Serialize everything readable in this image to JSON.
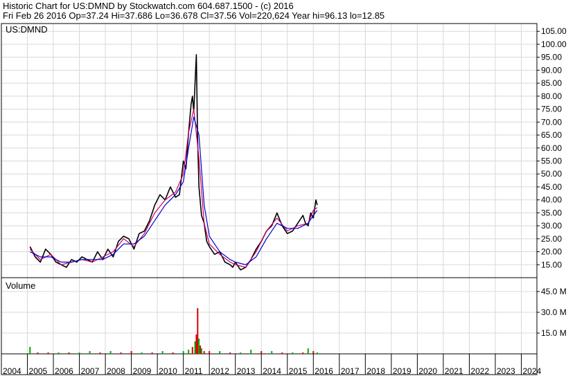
{
  "header": {
    "line1": "Historic Chart for US:DMND by Stockwatch.com 604.687.1500 - (c) 2016",
    "line2": "Fri Feb 26 2016   Op=37.24  Hi=37.686  Lo=36.678  Cl=37.56  Vol=220,624   Year hi=96.13   lo=12.85"
  },
  "chart_data": {
    "type": "line",
    "symbol_label": "US:DMND",
    "volume_label": "Volume",
    "price_axis": {
      "ylim": [
        10,
        108
      ],
      "ticks": [
        15,
        20,
        25,
        30,
        35,
        40,
        45,
        50,
        55,
        60,
        65,
        70,
        75,
        80,
        85,
        90,
        95,
        100,
        105
      ],
      "tick_labels": [
        "15.00",
        "20.00",
        "25.00",
        "30.00",
        "35.00",
        "40.00",
        "45.00",
        "50.00",
        "55.00",
        "60.00",
        "65.00",
        "70.00",
        "75.00",
        "80.00",
        "85.00",
        "90.00",
        "95.00",
        "100.00",
        "105.00"
      ]
    },
    "volume_axis": {
      "ylim": [
        0,
        55
      ],
      "ticks": [
        15,
        30,
        45
      ],
      "tick_labels": [
        "15.0 M",
        "30.0 M",
        "45.0 M"
      ]
    },
    "x_axis": {
      "range": [
        2004,
        2024.6
      ],
      "tick_labels": [
        "2004",
        "2005",
        "2006",
        "2007",
        "2008",
        "2009",
        "2010",
        "2011",
        "2012",
        "2013",
        "2014",
        "2015",
        "2016",
        "2017",
        "2018",
        "2019",
        "2020",
        "2021",
        "2022",
        "2023",
        "2024"
      ]
    },
    "grid": true,
    "colors": {
      "price": "#000000",
      "ma_short": "#cc0066",
      "ma_long": "#0000cc",
      "volume_up": "#00aa00",
      "volume_down": "#dd0000",
      "grid": "#d8d8d8"
    },
    "series": [
      {
        "key": "price",
        "x": [
          2005.1,
          2005.3,
          2005.5,
          2005.7,
          2005.9,
          2006.1,
          2006.3,
          2006.5,
          2006.7,
          2006.9,
          2007.1,
          2007.3,
          2007.5,
          2007.7,
          2007.9,
          2008.1,
          2008.3,
          2008.5,
          2008.7,
          2008.9,
          2009.1,
          2009.3,
          2009.5,
          2009.7,
          2009.9,
          2010.1,
          2010.3,
          2010.5,
          2010.7,
          2010.85,
          2011.0,
          2011.1,
          2011.2,
          2011.3,
          2011.35,
          2011.4,
          2011.5,
          2011.55,
          2011.6,
          2011.7,
          2011.8,
          2011.9,
          2012.0,
          2012.2,
          2012.4,
          2012.6,
          2012.8,
          2012.9,
          2013.0,
          2013.2,
          2013.4,
          2013.6,
          2013.8,
          2014.0,
          2014.2,
          2014.4,
          2014.6,
          2014.8,
          2015.0,
          2015.2,
          2015.4,
          2015.6,
          2015.7,
          2015.8,
          2015.9,
          2016.0,
          2016.1,
          2016.15
        ],
        "y": [
          22,
          18,
          16,
          21,
          19,
          16,
          15,
          14,
          17,
          16,
          18,
          17,
          16,
          20,
          17,
          21,
          18,
          24,
          26,
          25,
          21,
          27,
          28,
          32,
          38,
          42,
          40,
          45,
          41,
          42,
          55,
          52,
          66,
          77,
          80,
          74,
          96,
          63,
          45,
          34,
          31,
          24,
          22,
          19,
          20,
          16,
          15,
          14,
          16,
          13,
          14,
          17,
          21,
          24,
          28,
          30,
          35,
          30,
          27,
          28,
          31,
          34,
          31,
          30,
          35,
          33,
          40,
          38
        ]
      },
      {
        "key": "ma_short",
        "x": [
          2005.1,
          2005.5,
          2005.9,
          2006.3,
          2006.7,
          2007.1,
          2007.5,
          2007.9,
          2008.3,
          2008.7,
          2009.1,
          2009.5,
          2009.9,
          2010.3,
          2010.7,
          2011.0,
          2011.2,
          2011.4,
          2011.6,
          2011.8,
          2012.0,
          2012.4,
          2012.8,
          2013.0,
          2013.4,
          2013.8,
          2014.2,
          2014.6,
          2015.0,
          2015.4,
          2015.8,
          2016.0,
          2016.15
        ],
        "y": [
          21,
          17,
          19,
          15,
          16,
          17,
          16,
          18,
          20,
          25,
          22,
          27,
          35,
          40,
          43,
          50,
          66,
          75,
          56,
          31,
          23,
          19,
          16,
          15,
          14,
          20,
          28,
          33,
          28,
          30,
          31,
          36,
          37
        ]
      },
      {
        "key": "ma_long",
        "x": [
          2005.1,
          2005.5,
          2005.9,
          2006.3,
          2006.7,
          2007.1,
          2007.5,
          2007.9,
          2008.3,
          2008.7,
          2009.1,
          2009.5,
          2009.9,
          2010.3,
          2010.7,
          2011.0,
          2011.2,
          2011.4,
          2011.6,
          2011.8,
          2012.0,
          2012.4,
          2012.8,
          2013.0,
          2013.4,
          2013.8,
          2014.2,
          2014.6,
          2015.0,
          2015.4,
          2015.8,
          2016.0,
          2016.15
        ],
        "y": [
          20,
          18,
          18,
          16,
          16,
          17,
          17,
          17,
          19,
          23,
          23,
          26,
          32,
          38,
          42,
          47,
          60,
          72,
          65,
          38,
          26,
          20,
          17,
          16,
          15,
          18,
          25,
          31,
          29,
          29,
          31,
          34,
          36
        ]
      }
    ],
    "volume": {
      "x": [
        2005.1,
        2005.4,
        2005.8,
        2006.2,
        2006.6,
        2007.0,
        2007.4,
        2007.8,
        2008.2,
        2008.6,
        2009.0,
        2009.4,
        2009.8,
        2010.2,
        2010.6,
        2011.0,
        2011.2,
        2011.35,
        2011.45,
        2011.5,
        2011.55,
        2011.6,
        2011.65,
        2011.7,
        2011.8,
        2012.0,
        2012.4,
        2012.8,
        2013.2,
        2013.6,
        2014.0,
        2014.4,
        2014.8,
        2015.2,
        2015.6,
        2015.8,
        2016.0,
        2016.15
      ],
      "values": [
        5,
        1,
        1,
        1,
        1,
        1,
        2,
        1,
        2,
        1,
        2,
        1,
        1,
        2,
        1,
        2,
        3,
        5,
        9,
        14,
        33,
        11,
        6,
        4,
        2,
        2,
        2,
        1,
        1,
        3,
        2,
        2,
        1,
        1,
        1,
        4,
        2,
        1
      ],
      "up": [
        true,
        false,
        false,
        true,
        false,
        true,
        true,
        false,
        true,
        false,
        false,
        true,
        false,
        true,
        false,
        true,
        true,
        false,
        true,
        false,
        false,
        true,
        false,
        true,
        false,
        false,
        true,
        false,
        true,
        true,
        false,
        true,
        false,
        true,
        false,
        true,
        false,
        true
      ]
    }
  }
}
